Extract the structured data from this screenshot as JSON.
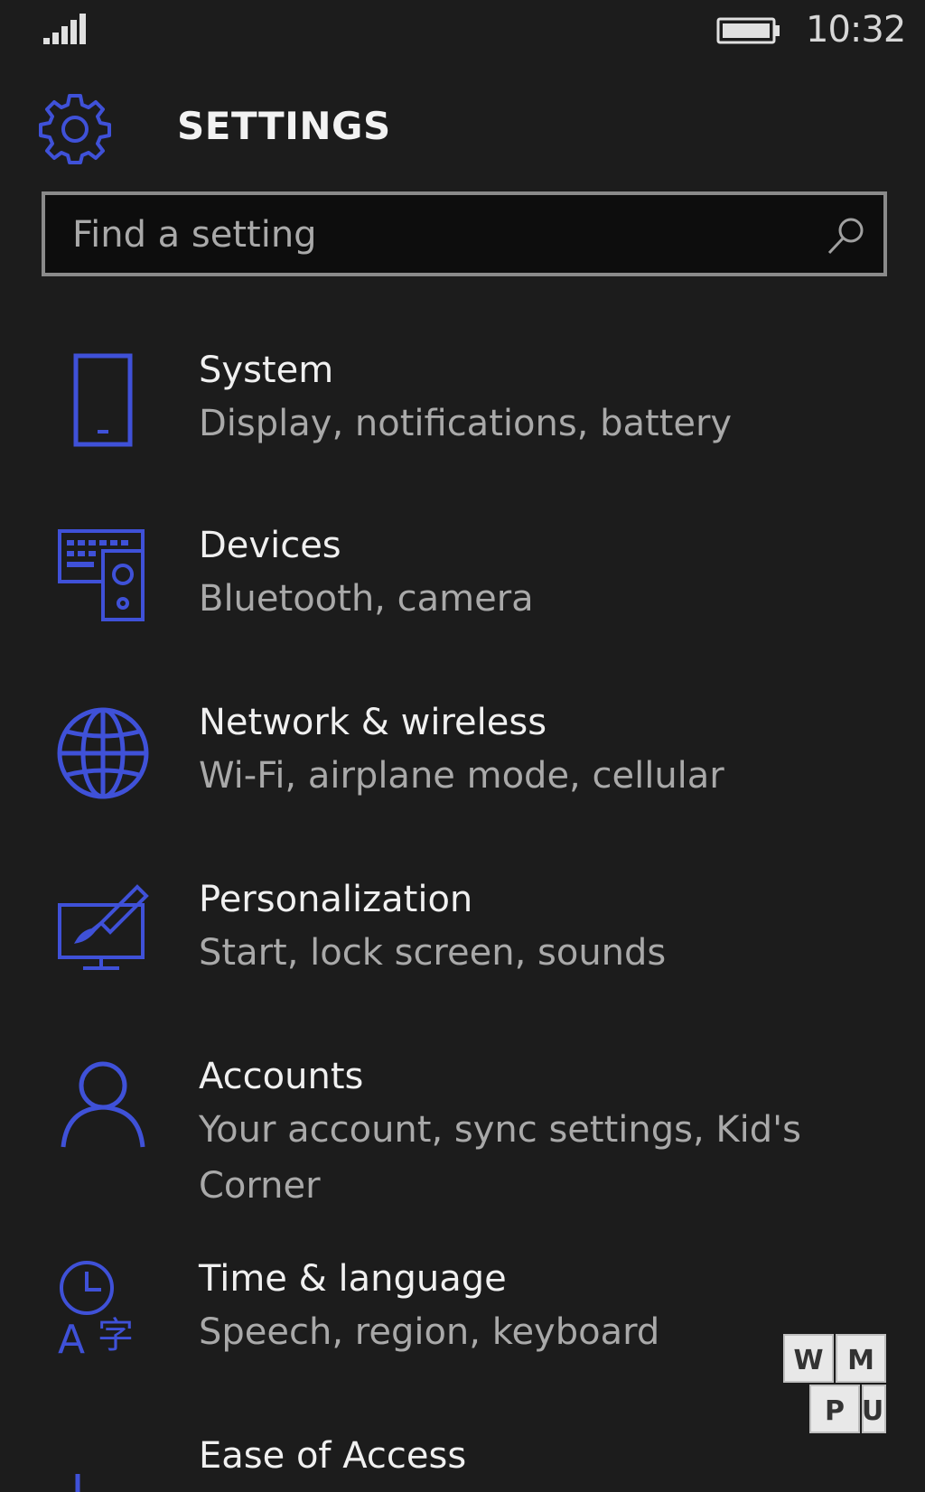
{
  "status_bar": {
    "time": "10:32",
    "signal_icon": "signal-bars-icon",
    "battery_icon": "battery-icon"
  },
  "header": {
    "icon": "gear-icon",
    "title": "SETTINGS"
  },
  "search": {
    "placeholder": "Find a setting",
    "value": "",
    "icon": "search-icon"
  },
  "settings": [
    {
      "title": "System",
      "subtitle": "Display, notifications, battery",
      "icon": "phone-icon"
    },
    {
      "title": "Devices",
      "subtitle": "Bluetooth, camera",
      "icon": "devices-icon"
    },
    {
      "title": "Network & wireless",
      "subtitle": "Wi-Fi, airplane mode, cellular",
      "icon": "globe-icon"
    },
    {
      "title": "Personalization",
      "subtitle": "Start, lock screen, sounds",
      "icon": "personalization-icon"
    },
    {
      "title": "Accounts",
      "subtitle": "Your account, sync settings, Kid's Corner",
      "icon": "person-icon"
    },
    {
      "title": "Time & language",
      "subtitle": "Speech, region, keyboard",
      "icon": "time-language-icon"
    },
    {
      "title": "Ease of Access",
      "subtitle": "",
      "icon": "ease-of-access-icon"
    }
  ],
  "watermark": {
    "letters": [
      "W",
      "M",
      "P",
      "U"
    ]
  },
  "colors": {
    "background": "#1c1c1c",
    "accent": "#3f51d8",
    "title_text": "#f0f0f0",
    "subtitle_text": "#a9a9a9"
  }
}
